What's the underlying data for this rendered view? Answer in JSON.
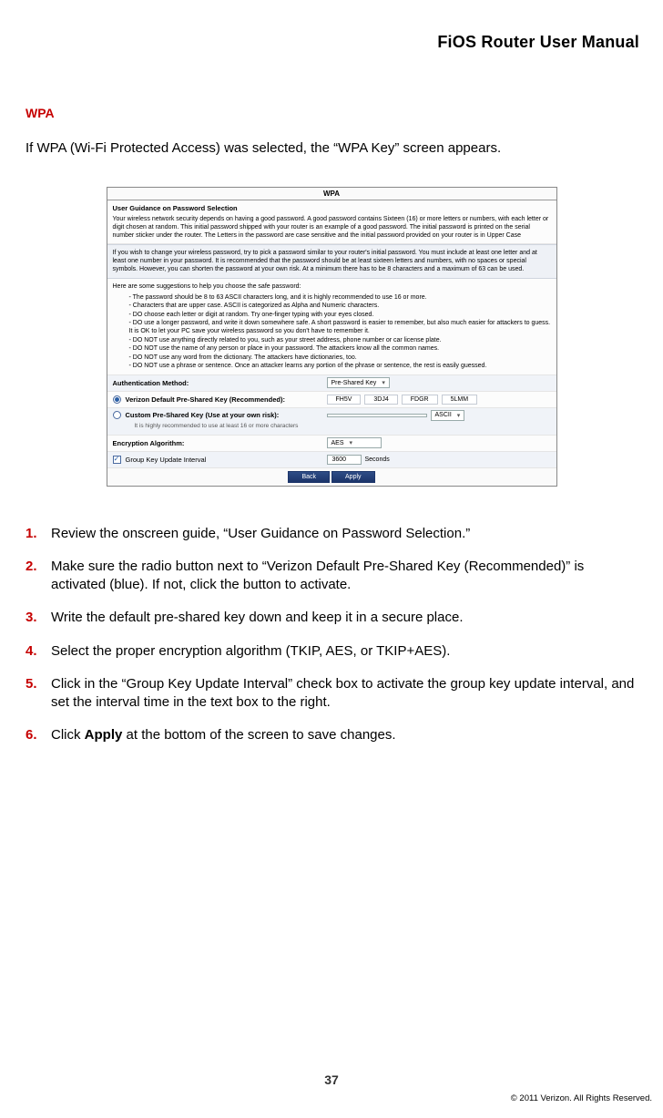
{
  "header": {
    "title": "FiOS Router User Manual"
  },
  "section": {
    "heading": "WPA",
    "intro": "If WPA (Wi-Fi Protected Access) was selected, the “WPA Key” screen appears."
  },
  "panel": {
    "title": "WPA",
    "guidance_heading": "User Guidance on Password Selection",
    "para1": "Your wireless network security depends on having a good password. A good password contains Sixteen (16) or more letters or numbers, with each letter or digit chosen at random. This initial password shipped with your router is an example of a good password. The initial password is printed on the serial number sticker under the router. The Letters in the password are case sensitive and the initial password provided on your router is in Upper Case",
    "para2": "If you wish to change your wireless password, try to pick a password similar to your router's initial password. You must include at least one letter and at least one number in your password. It is recommended that the password should be at least sixteen letters and numbers, with no spaces or special symbols. However, you can shorten the password at your own risk. At a minimum there has to be 8 characters and a maximum of 63 can be used.",
    "para3": "Here are some suggestions to help you choose the safe password:",
    "bullets": [
      "The password should be 8 to 63 ASCII characters long, and it is highly recommended to use 16 or more.",
      "Characters that are upper case. ASCII is categorized as Alpha and Numeric characters.",
      "DO choose each letter or digit at random. Try one-finger typing with your eyes closed.",
      "DO use a longer password, and write it down somewhere safe. A short password is easier to remember, but also much easier for attackers to guess. It is OK to let your PC save your wireless password so you don't have to remember it.",
      "DO NOT use anything directly related to you, such as your street address, phone number or car license plate.",
      "DO NOT use the name of any person or place in your password. The attackers know all the common names.",
      "DO NOT use any word from the dictionary. The attackers have dictionaries, too.",
      "DO NOT use a phrase or sentence. Once an attacker learns any portion of the phrase or sentence, the rest is easily guessed."
    ],
    "auth_method_label": "Authentication Method:",
    "auth_method_value": "Pre-Shared Key",
    "option_default_label": "Verizon Default Pre-Shared Key (Recommended):",
    "default_key": [
      "FH5V",
      "3DJ4",
      "FDGR",
      "5LMM"
    ],
    "option_custom_label": "Custom Pre-Shared Key (Use at your own risk):",
    "custom_hint": "It is highly recommended to use at least 16 or more characters",
    "custom_charset": "ASCII",
    "enc_label": "Encryption Algorithm:",
    "enc_value": "AES",
    "gku_label": "Group Key Update Interval",
    "gku_value": "3600",
    "gku_unit": "Seconds",
    "buttons": {
      "back": "Back",
      "apply": "Apply"
    }
  },
  "steps": [
    "Review the onscreen guide, “User Guidance on Password Selection.”",
    "Make sure the radio button next to “Verizon Default Pre-Shared Key (Recommended)” is activated (blue). If not, click the button to activate.",
    "Write the default pre-shared key down and keep it in a secure place.",
    "Select the proper encryption algorithm (TKIP, AES, or TKIP+AES).",
    "Click in the “Group Key Update Interval” check box to activate the group key update interval, and set the interval time in the text box to the right.",
    "Click <b>Apply</b> at the bottom of the screen to save changes."
  ],
  "footer": {
    "page": "37",
    "copyright": "© 2011 Verizon. All Rights Reserved."
  }
}
